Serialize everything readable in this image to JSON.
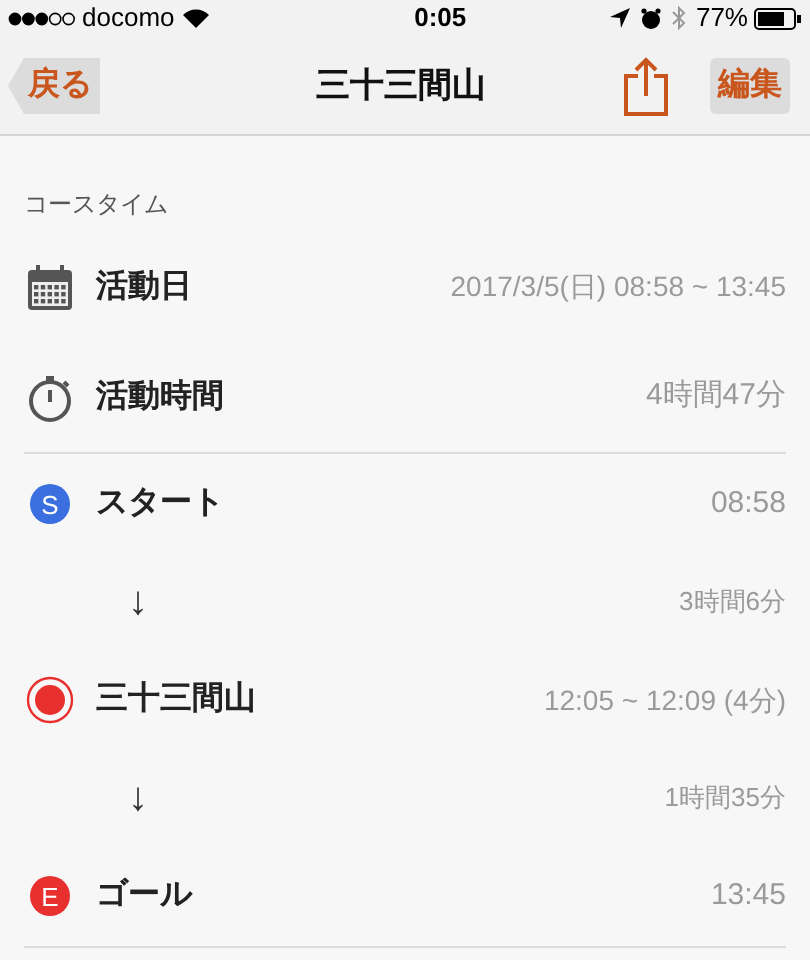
{
  "status_bar": {
    "carrier": "docomo",
    "time": "0:05",
    "battery": "77%"
  },
  "nav": {
    "back": "戻る",
    "title": "三十三間山",
    "edit": "編集"
  },
  "section": {
    "title": "コースタイム"
  },
  "rows": [
    {
      "kind": "calendar",
      "label": "活動日",
      "value": "2017/3/5(日) 08:58 ~ 13:45"
    },
    {
      "kind": "stopwatch",
      "label": "活動時間",
      "value": "4時間47分"
    },
    {
      "kind": "divider"
    },
    {
      "kind": "start",
      "badge": "S",
      "label": "スタート",
      "value": "08:58"
    },
    {
      "kind": "arrow",
      "arrow": "↓",
      "value": "3時間6分"
    },
    {
      "kind": "waypoint",
      "label": "三十三間山",
      "value": "12:05 ~ 12:09 (4分)"
    },
    {
      "kind": "arrow",
      "arrow": "↓",
      "value": "1時間35分"
    },
    {
      "kind": "goal",
      "badge": "E",
      "label": "ゴール",
      "value": "13:45"
    },
    {
      "kind": "divider"
    }
  ]
}
